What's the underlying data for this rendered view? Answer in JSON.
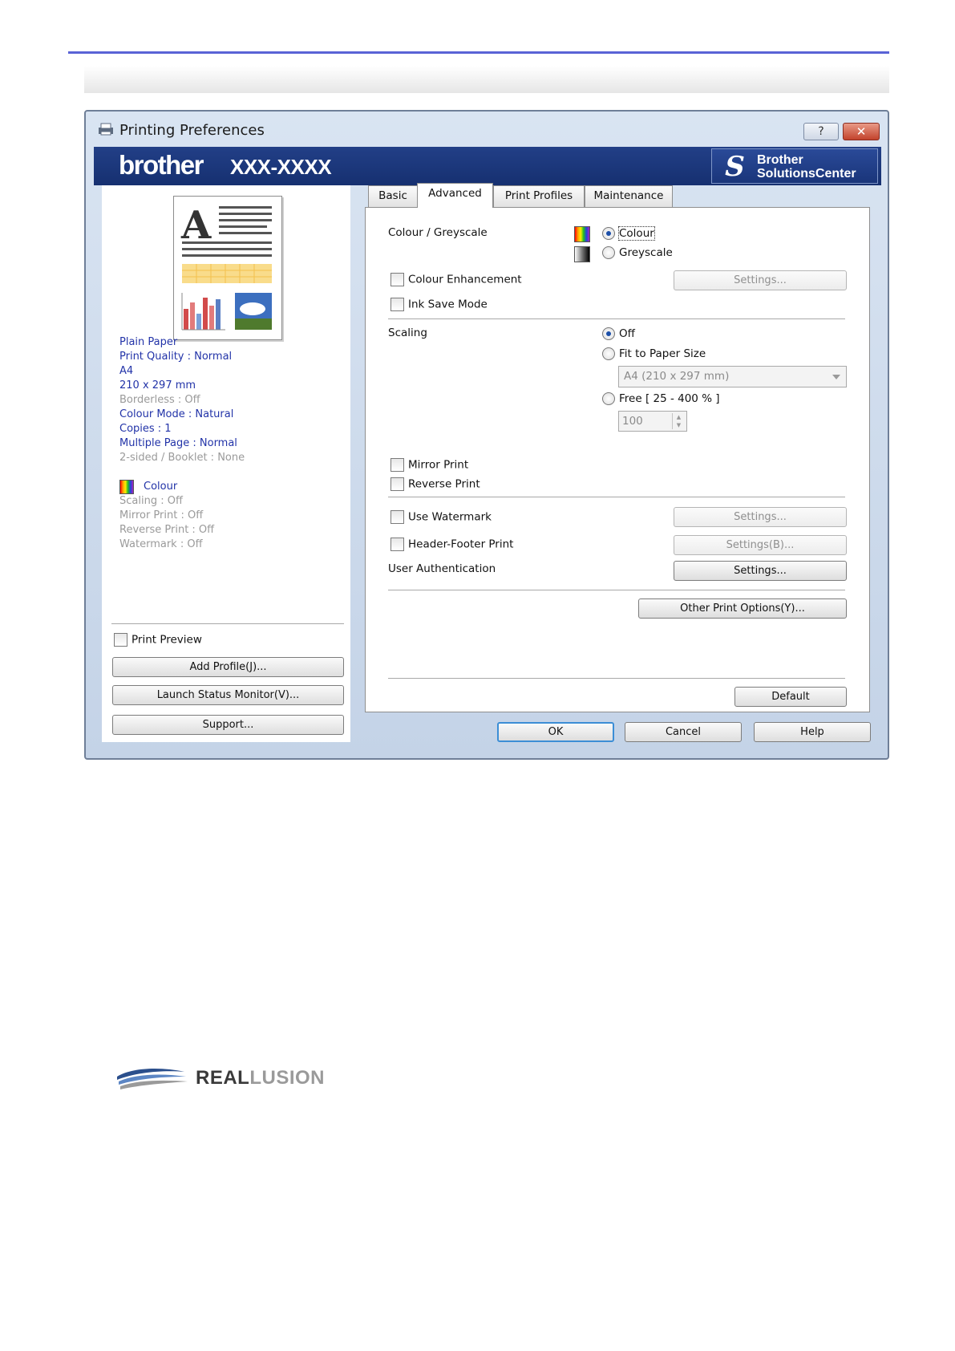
{
  "window": {
    "title": "Printing Preferences",
    "help_button": "?",
    "close_button": "✕"
  },
  "banner": {
    "brand": "brother",
    "model": "XXX-XXXX",
    "solutions_center": {
      "line1": "Brother",
      "line2": "SolutionsCenter"
    }
  },
  "summary": {
    "items": [
      {
        "text": "Plain Paper",
        "state": "active"
      },
      {
        "text": "Print Quality : Normal",
        "state": "active"
      },
      {
        "text": "A4",
        "state": "active"
      },
      {
        "text": "210 x 297 mm",
        "state": "active"
      },
      {
        "text": "Borderless : Off",
        "state": "dim"
      },
      {
        "text": "Colour Mode : Natural",
        "state": "active"
      },
      {
        "text": "Copies : 1",
        "state": "active"
      },
      {
        "text": "Multiple Page : Normal",
        "state": "active"
      },
      {
        "text": "2-sided / Booklet : None",
        "state": "dim"
      }
    ],
    "colour_label": "Colour",
    "items2": [
      "Scaling : Off",
      "Mirror Print : Off",
      "Reverse Print : Off",
      "Watermark : Off"
    ]
  },
  "left_controls": {
    "print_preview": "Print Preview",
    "add_profile": "Add Profile(J)...",
    "launch_status_monitor": "Launch Status Monitor(V)...",
    "support": "Support..."
  },
  "tabs": [
    "Basic",
    "Advanced",
    "Print Profiles",
    "Maintenance"
  ],
  "advanced": {
    "colour_greyscale_label": "Colour / Greyscale",
    "colour_option": "Colour",
    "greyscale_option": "Greyscale",
    "colour_enhancement": "Colour Enhancement",
    "colour_enhancement_settings": "Settings...",
    "ink_save_mode": "Ink Save Mode",
    "scaling_label": "Scaling",
    "scaling_off": "Off",
    "fit_to_paper_size": "Fit to Paper Size",
    "paper_size_value": "A4 (210 x 297 mm)",
    "free_scaling": "Free [ 25 - 400 % ]",
    "free_value": "100",
    "mirror_print": "Mirror Print",
    "reverse_print": "Reverse Print",
    "use_watermark": "Use Watermark",
    "watermark_settings": "Settings...",
    "header_footer_print": "Header-Footer Print",
    "header_footer_settings": "Settings(B)...",
    "user_authentication": "User Authentication",
    "user_auth_settings": "Settings...",
    "other_print_options": "Other Print Options(Y)...",
    "default": "Default"
  },
  "footer_buttons": {
    "ok": "OK",
    "cancel": "Cancel",
    "help": "Help"
  },
  "watermark_logo": {
    "strong": "REAL",
    "light": "LUSION"
  },
  "colors": {
    "accent_rule": "#5a63d6",
    "banner": "#1c3a80",
    "summary_text": "#2233a8"
  }
}
